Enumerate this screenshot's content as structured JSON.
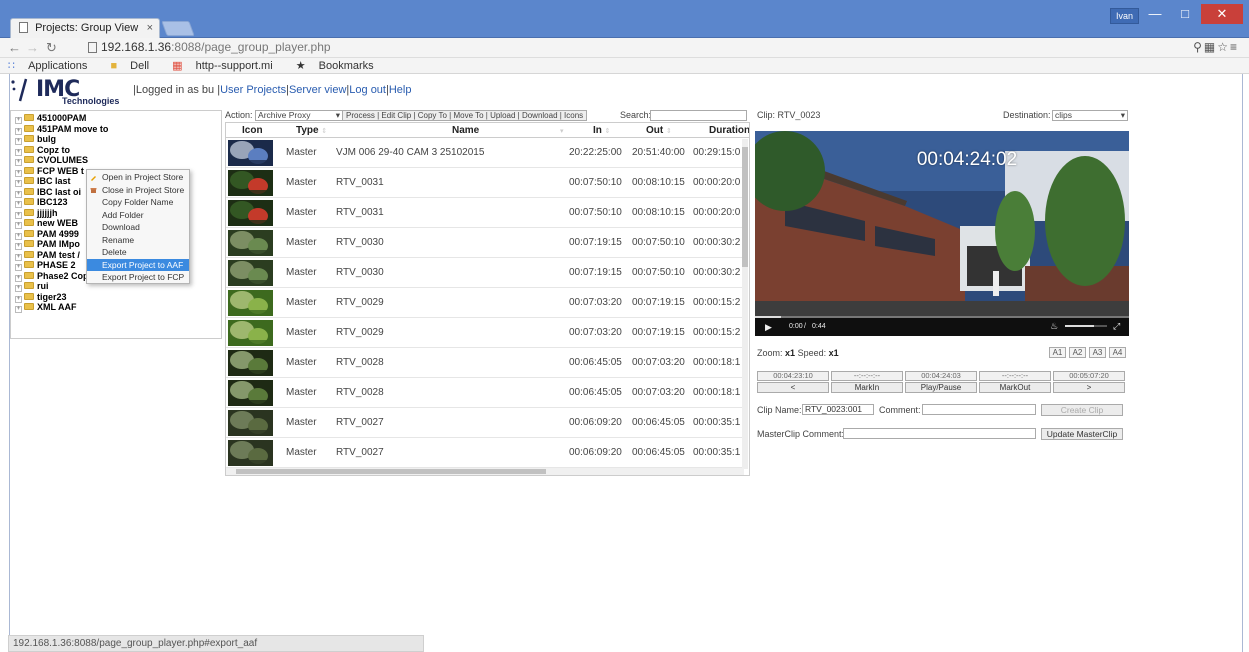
{
  "browser": {
    "tab_title": "Projects: Group View",
    "tab_close": "×",
    "user_chip": "Ivan",
    "url_host": "192.168.1.36",
    "url_rest": ":8088/page_group_player.php",
    "bookmarks": [
      "Applications",
      "Dell",
      "http--support.mi",
      "Bookmarks"
    ]
  },
  "header": {
    "logo_word": "IMC",
    "logo_sub": "Technologies",
    "logged_in": "|Logged in as bu |",
    "links": [
      "User Projects",
      "Server view",
      "Log out",
      "Help"
    ]
  },
  "tree": {
    "items": [
      "451000PAM",
      "451PAM move to",
      "bulg",
      "Copz to",
      "CVOLUMES",
      "FCP WEB t",
      "IBC last",
      "IBC last oi",
      "IBC123",
      "jjjjjjh",
      "new WEB",
      "PAM 4999",
      "PAM IMpo",
      "PAM test /",
      "PHASE 2",
      "Phase2 Copty to",
      "rui",
      "tiger23",
      "XML AAF"
    ]
  },
  "context_menu": {
    "items": [
      "Open in Project Store",
      "Close in Project Store",
      "Copy Folder Name",
      "Add Folder",
      "Download",
      "Rename",
      "Delete",
      "Export Project to AAF",
      "Export Project to FCP"
    ],
    "selected_index": 7
  },
  "actions": {
    "label": "Action:",
    "selected": "Archive Proxy",
    "buttons": "Process | Edit Clip | Copy To | Move To | Upload | Download | Icons",
    "search_label": "Search:",
    "search_value": ""
  },
  "table": {
    "headers": {
      "icon": "Icon",
      "type": "Type",
      "name": "Name",
      "in": "In",
      "out": "Out",
      "duration": "Duration"
    },
    "rows": [
      {
        "type": "Master",
        "name": "VJM 006 29-40 CAM 3 25102015",
        "in": "20:22:25:00",
        "out": "20:51:40:00",
        "duration": "00:29:15:0"
      },
      {
        "type": "Master",
        "name": "RTV_0031",
        "in": "00:07:50:10",
        "out": "00:08:10:15",
        "duration": "00:00:20:0"
      },
      {
        "type": "Master",
        "name": "RTV_0031",
        "in": "00:07:50:10",
        "out": "00:08:10:15",
        "duration": "00:00:20:0"
      },
      {
        "type": "Master",
        "name": "RTV_0030",
        "in": "00:07:19:15",
        "out": "00:07:50:10",
        "duration": "00:00:30:2"
      },
      {
        "type": "Master",
        "name": "RTV_0030",
        "in": "00:07:19:15",
        "out": "00:07:50:10",
        "duration": "00:00:30:2"
      },
      {
        "type": "Master",
        "name": "RTV_0029",
        "in": "00:07:03:20",
        "out": "00:07:19:15",
        "duration": "00:00:15:2"
      },
      {
        "type": "Master",
        "name": "RTV_0029",
        "in": "00:07:03:20",
        "out": "00:07:19:15",
        "duration": "00:00:15:2"
      },
      {
        "type": "Master",
        "name": "RTV_0028",
        "in": "00:06:45:05",
        "out": "00:07:03:20",
        "duration": "00:00:18:1"
      },
      {
        "type": "Master",
        "name": "RTV_0028",
        "in": "00:06:45:05",
        "out": "00:07:03:20",
        "duration": "00:00:18:1"
      },
      {
        "type": "Master",
        "name": "RTV_0027",
        "in": "00:06:09:20",
        "out": "00:06:45:05",
        "duration": "00:00:35:1"
      },
      {
        "type": "Master",
        "name": "RTV_0027",
        "in": "00:06:09:20",
        "out": "00:06:45:05",
        "duration": "00:00:35:1"
      }
    ]
  },
  "player": {
    "clip_label": "Clip: RTV_0023",
    "destination_label": "Destination:",
    "destination_value": "clips",
    "timecode": "00:04:24:02",
    "time_current": "0:00",
    "time_sep": "/",
    "time_total": "0:44",
    "progress_fraction": 0.07,
    "volume_fraction": 0.7,
    "zoom_label": "Zoom:",
    "zoom_value": "x1",
    "speed_label": "Speed:",
    "speed_value": "x1",
    "audio_buttons": [
      "A1",
      "A2",
      "A3",
      "A4"
    ],
    "timecodes": [
      "00:04:23:10",
      "--:--:--:--",
      "00:04:24:03",
      "--:--:--:--",
      "00:05:07:20"
    ],
    "controls": [
      "<",
      "MarkIn",
      "Play/Pause",
      "MarkOut",
      ">"
    ],
    "clip_name_label": "Clip Name:",
    "clip_name_value": "RTV_0023:001",
    "comment_label": "Comment:",
    "comment_value": "",
    "create_clip": "Create Clip",
    "master_comment_label": "MasterClip Comment:",
    "master_comment_value": "",
    "update_master": "Update MasterClip"
  },
  "statusbar": "192.168.1.36:8088/page_group_player.php#export_aaf"
}
